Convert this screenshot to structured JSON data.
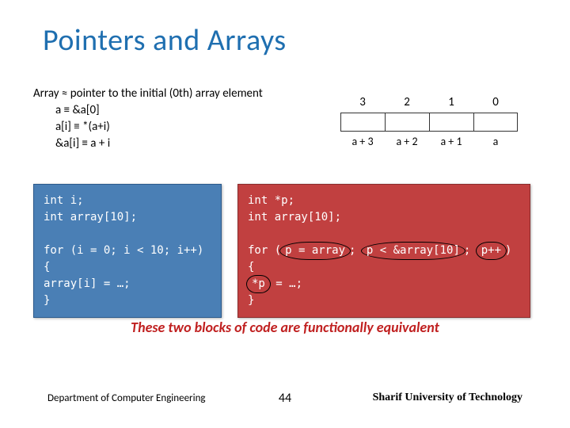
{
  "title": "Pointers and Arrays",
  "explain": {
    "line1": "Array ≈ pointer to the initial (0th) array element",
    "line2": "a    ≡  &a[0]",
    "line3": "a[i]  ≡  *(a+i)",
    "line4": "&a[i] ≡  a + i"
  },
  "diagram": {
    "indices": [
      "3",
      "2",
      "1",
      "0"
    ],
    "labels": [
      "a + 3",
      "a + 2",
      "a + 1",
      "a"
    ]
  },
  "code_left": {
    "l1": "int  i;",
    "l2": "int  array[10];",
    "l3": "",
    "l4": "for (i = 0; i < 10; i++)",
    "l5": "{",
    "l6": "  array[i] = …;",
    "l7": "}"
  },
  "code_right": {
    "l1": "int *p;",
    "l2": "int  array[10];",
    "l3": "",
    "l4a": "for (",
    "l4b": "p = array",
    "l4c": "; ",
    "l4d": "p < &array[10]",
    "l4e": "; ",
    "l4f": "p++",
    "l4g": ")",
    "l5": "{",
    "l6a": "  ",
    "l6b": "*p",
    "l6c": " = …;",
    "l7": "}"
  },
  "equivalence": "These two blocks of code are functionally equivalent",
  "footer": {
    "left": "Department of Computer Engineering",
    "page": "44",
    "right": "Sharif University of Technology"
  }
}
